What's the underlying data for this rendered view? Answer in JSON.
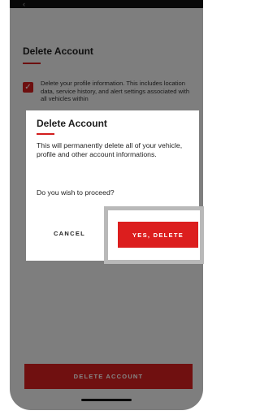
{
  "screen": {
    "title": "Delete Account",
    "description": "Delete your profile information. This includes location data, service history, and alert settings associated with all vehicles within",
    "checkbox_checked": true,
    "delete_button_label": "DELETE ACCOUNT",
    "back_glyph": "‹"
  },
  "dialog": {
    "title": "Delete Account",
    "body": "This will permanently delete all of your vehicle, profile and other account informations.",
    "question": "Do you wish to proceed?",
    "cancel_label": "CANCEL",
    "confirm_label": "YES, DELETE"
  },
  "colors": {
    "accent": "#d7201f",
    "overlay": "rgba(0,0,0,0.48)"
  },
  "icons": {
    "checkbox": "check-icon",
    "back": "chevron-left-icon"
  }
}
